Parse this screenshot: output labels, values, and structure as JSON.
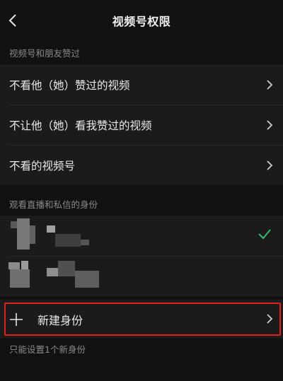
{
  "nav": {
    "title": "视频号权限",
    "back_icon": "chevron-left-icon"
  },
  "section1": {
    "label": "视频号和朋友赞过",
    "items": [
      {
        "label": "不看他（她）赞过的视频"
      },
      {
        "label": "不让他（她）看我赞过的视频"
      },
      {
        "label": "不看的视频号"
      }
    ]
  },
  "section2": {
    "label": "观看直播和私信的身份",
    "identities": [
      {
        "selected": true
      },
      {
        "selected": false
      }
    ]
  },
  "new_identity": {
    "label": "新建身份"
  },
  "hint": "只能设置1个新身份",
  "colors": {
    "accent": "#2fc16a",
    "highlight": "#e0201a",
    "background": "#111111",
    "row": "#1b1b1b"
  }
}
